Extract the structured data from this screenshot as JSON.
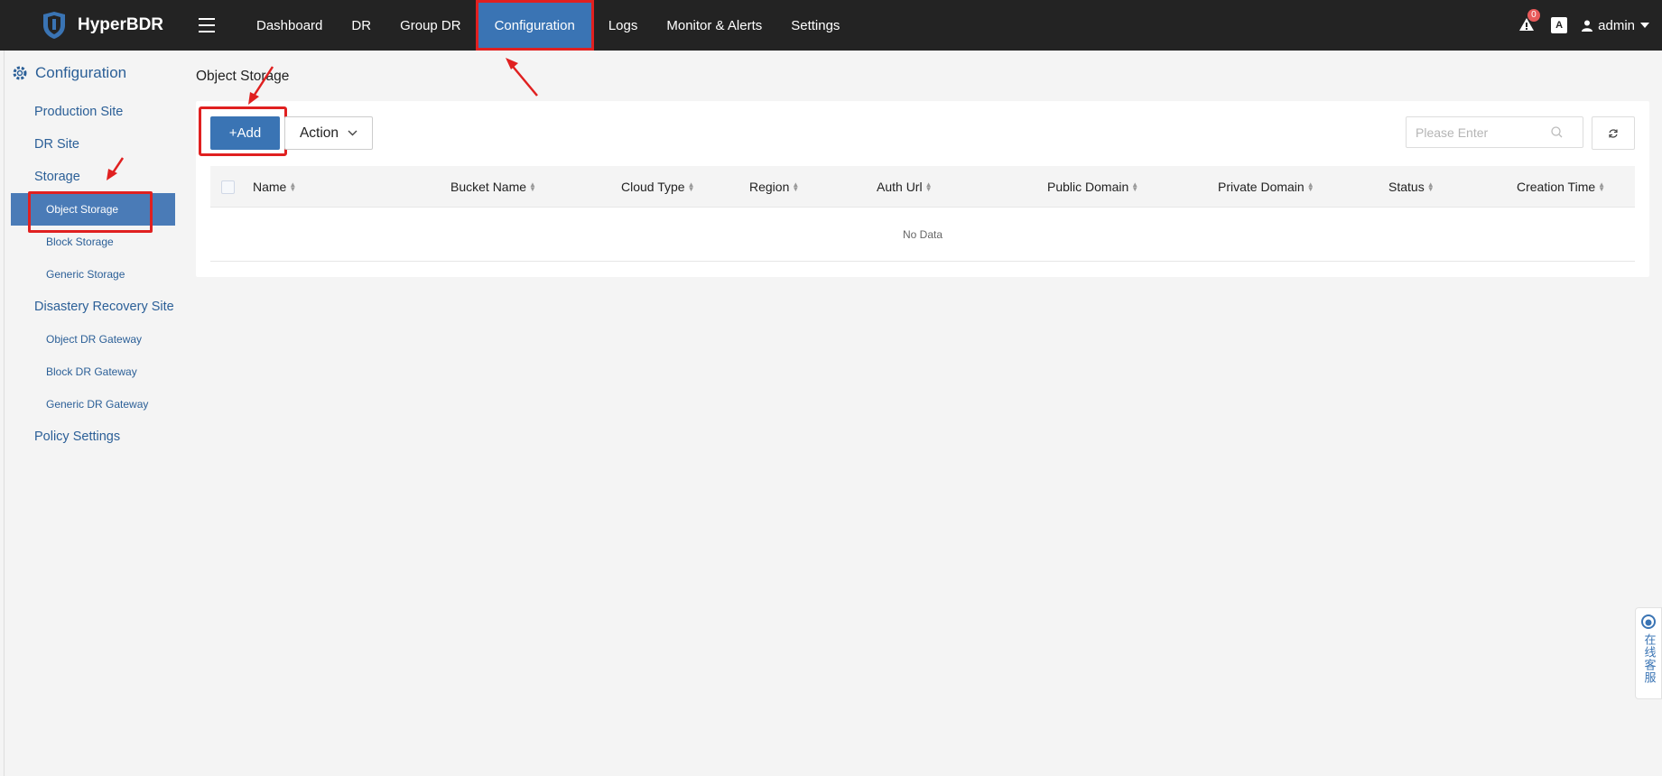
{
  "app": {
    "title": "HyperBDR"
  },
  "nav": {
    "items": [
      {
        "label": "Dashboard"
      },
      {
        "label": "DR"
      },
      {
        "label": "Group DR"
      },
      {
        "label": "Configuration",
        "active": true
      },
      {
        "label": "Logs"
      },
      {
        "label": "Monitor & Alerts"
      },
      {
        "label": "Settings"
      }
    ]
  },
  "topright": {
    "alert_count": "0",
    "lang_icon": "A",
    "user": "admin"
  },
  "sidebar": {
    "header": "Configuration",
    "items": {
      "production_site": "Production Site",
      "dr_site": "DR Site",
      "storage": "Storage",
      "object_storage": "Object Storage",
      "block_storage": "Block Storage",
      "generic_storage": "Generic Storage",
      "disaster_recovery_site": "Disastery Recovery Site",
      "object_dr_gateway": "Object DR Gateway",
      "block_dr_gateway": "Block DR Gateway",
      "generic_dr_gateway": "Generic DR Gateway",
      "policy_settings": "Policy Settings"
    }
  },
  "main": {
    "breadcrumb": "Object Storage",
    "add_label": "+Add",
    "action_label": "Action",
    "search_placeholder": "Please Enter",
    "columns": {
      "name": "Name",
      "bucket_name": "Bucket Name",
      "cloud_type": "Cloud Type",
      "region": "Region",
      "auth_url": "Auth Url",
      "public_domain": "Public Domain",
      "private_domain": "Private Domain",
      "status": "Status",
      "creation_time": "Creation Time"
    },
    "empty_text": "No Data"
  },
  "service_widget": {
    "label": "在线客服"
  },
  "colors": {
    "topbar": "#232323",
    "accent": "#3a74b4",
    "highlight": "#e02020"
  }
}
